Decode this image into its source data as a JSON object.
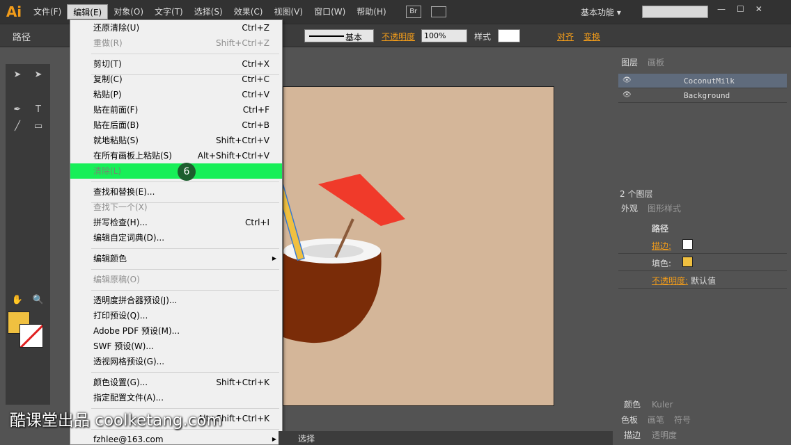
{
  "app": {
    "logo": "Ai",
    "workspace": "基本功能",
    "bridge": "Br"
  },
  "menubar": [
    "文件(F)",
    "编辑(E)",
    "对象(O)",
    "文字(T)",
    "选择(S)",
    "效果(C)",
    "视图(V)",
    "窗口(W)",
    "帮助(H)"
  ],
  "control": {
    "selection": "路径",
    "stroke_style": "基本",
    "opacity_label": "不透明度",
    "opacity_value": "100%",
    "style_label": "样式",
    "align_label": "对齐",
    "transform_label": "变换"
  },
  "edit_menu": [
    {
      "label": "还原清除(U)",
      "shortcut": "Ctrl+Z"
    },
    {
      "label": "重做(R)",
      "shortcut": "Shift+Ctrl+Z",
      "disabled": true
    },
    {
      "label": "剪切(T)",
      "shortcut": "Ctrl+X"
    },
    {
      "label": "复制(C)",
      "shortcut": "Ctrl+C"
    },
    {
      "label": "粘贴(P)",
      "shortcut": "Ctrl+V"
    },
    {
      "label": "贴在前面(F)",
      "shortcut": "Ctrl+F"
    },
    {
      "label": "贴在后面(B)",
      "shortcut": "Ctrl+B"
    },
    {
      "label": "就地粘贴(S)",
      "shortcut": "Shift+Ctrl+V"
    },
    {
      "label": "在所有画板上粘贴(S)",
      "shortcut": "Alt+Shift+Ctrl+V"
    },
    {
      "label": "清除(L)",
      "shortcut": "",
      "highlight": true
    },
    {
      "label": "查找和替换(E)...",
      "shortcut": ""
    },
    {
      "label": "查找下一个(X)",
      "shortcut": "",
      "disabled": true
    },
    {
      "label": "拼写检查(H)...",
      "shortcut": "Ctrl+I"
    },
    {
      "label": "编辑自定词典(D)...",
      "shortcut": ""
    },
    {
      "label": "编辑颜色",
      "shortcut": "",
      "submenu": true
    },
    {
      "label": "编辑原稿(O)",
      "shortcut": "",
      "disabled": true
    },
    {
      "label": "透明度拼合器预设(J)...",
      "shortcut": ""
    },
    {
      "label": "打印预设(Q)...",
      "shortcut": ""
    },
    {
      "label": "Adobe PDF 预设(M)...",
      "shortcut": ""
    },
    {
      "label": "SWF 预设(W)...",
      "shortcut": ""
    },
    {
      "label": "透视网格预设(G)...",
      "shortcut": ""
    },
    {
      "label": "颜色设置(G)...",
      "shortcut": "Shift+Ctrl+K"
    },
    {
      "label": "指定配置文件(A)...",
      "shortcut": ""
    },
    {
      "label": "",
      "shortcut": "Alt+Shift+Ctrl+K"
    },
    {
      "label": "fzhlee@163.com",
      "shortcut": "",
      "submenu": true
    }
  ],
  "step_badge": "6",
  "layers_panel": {
    "tabs": [
      "图层",
      "画板"
    ],
    "layers": [
      "CoconutMilk",
      "Background"
    ],
    "count": "2 个图层"
  },
  "appearance_panel": {
    "tabs": [
      "外观",
      "图形样式"
    ],
    "title": "路径",
    "stroke_label": "描边:",
    "fill_label": "填色:",
    "opacity_label": "不透明度:",
    "opacity_value": "默认值"
  },
  "bottom_panels": [
    [
      "颜色",
      "Kuler"
    ],
    [
      "色板",
      "画笔",
      "符号"
    ],
    [
      "描边",
      "透明度"
    ]
  ],
  "status": {
    "tool": "选择"
  },
  "watermark": "酷课堂出品 coolketang.com"
}
